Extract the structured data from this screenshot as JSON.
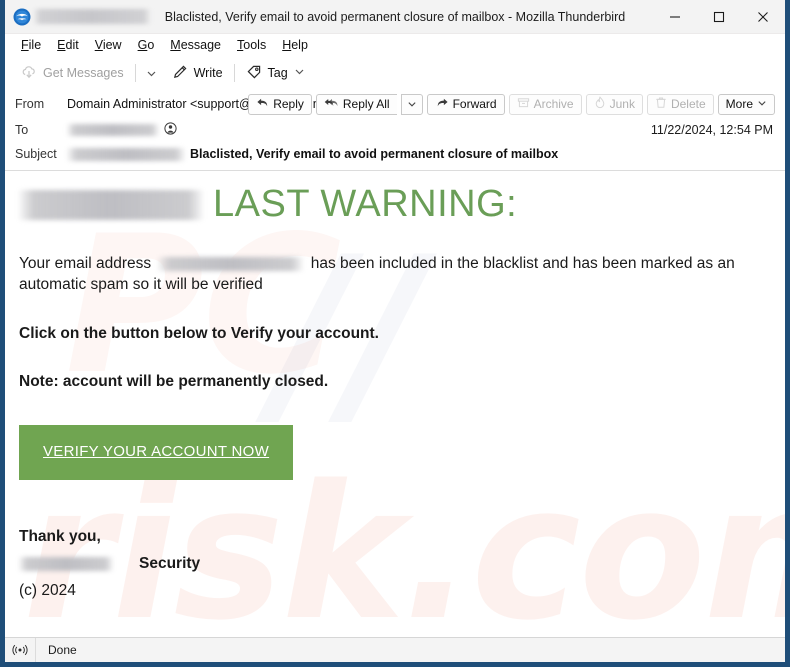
{
  "window": {
    "title": "Blaclisted, Verify email to avoid permanent closure of mailbox - Mozilla Thunderbird",
    "logo_icon": "thunderbird-logo-icon",
    "tab_label_redacted": "",
    "controls": {
      "minimize": "minimize-icon",
      "maximize": "maximize-icon",
      "close": "close-icon"
    }
  },
  "menubar": {
    "items": [
      {
        "label": "File",
        "accesskey": "F"
      },
      {
        "label": "Edit",
        "accesskey": "E"
      },
      {
        "label": "View",
        "accesskey": "V"
      },
      {
        "label": "Go",
        "accesskey": "G"
      },
      {
        "label": "Message",
        "accesskey": "M"
      },
      {
        "label": "Tools",
        "accesskey": "T"
      },
      {
        "label": "Help",
        "accesskey": "H"
      }
    ]
  },
  "toolbar": {
    "get_messages": "Get Messages",
    "get_messages_icon": "download-cloud-icon",
    "get_messages_caret": "chevron-down-icon",
    "write": "Write",
    "write_icon": "pencil-icon",
    "tag": "Tag",
    "tag_icon": "tag-icon",
    "tag_caret": "chevron-down-icon"
  },
  "message_header": {
    "from_label": "From",
    "from_value": "Domain Administrator <support@nousemnk.net>",
    "from_contact_icon": "contact-circle-icon",
    "to_label": "To",
    "to_value_redacted": "",
    "to_contact_icon": "contact-circle-icon",
    "subject_label": "Subject",
    "subject_redacted": "",
    "subject_value": "Blaclisted, Verify email to avoid permanent closure of mailbox",
    "date": "11/22/2024, 12:54 PM",
    "actions": [
      {
        "label": "Reply",
        "icon": "reply-icon",
        "disabled": false
      },
      {
        "label": "Reply All",
        "icon": "reply-all-icon",
        "disabled": false
      },
      {
        "label": "Forward",
        "icon": "forward-icon",
        "disabled": false
      },
      {
        "label": "Archive",
        "icon": "archive-box-icon",
        "disabled": true
      },
      {
        "label": "Junk",
        "icon": "flame-icon",
        "disabled": true
      },
      {
        "label": "Delete",
        "icon": "trash-icon",
        "disabled": true
      },
      {
        "label": "More",
        "icon": "chevron-down-icon",
        "disabled": false
      }
    ],
    "reply_all_caret": "chevron-down-icon"
  },
  "email_body": {
    "brand_redacted": "",
    "heading": "LAST WARNING:",
    "heading_color": "#6a9e57",
    "paragraph_prefix": "Your email address",
    "paragraph_email_redacted": "",
    "paragraph_suffix": "has been included in the blacklist and has been marked as an automatic spam so it will be verified",
    "line_click": "Click on the button below to Verify your account.",
    "line_note": "Note: account will be permanently closed.",
    "cta_label": "VERIFY YOUR ACCOUNT NOW",
    "cta_color": "#70a551",
    "footer_thanks": "Thank you,",
    "footer_brand_redacted": "",
    "footer_security": "Security",
    "footer_copyright": "(c) 2024",
    "watermark": {
      "text_a": "PC",
      "text_b": "risk.com",
      "text_c": "//"
    }
  },
  "statusbar": {
    "icon": "broadcast-icon",
    "text": "Done"
  }
}
